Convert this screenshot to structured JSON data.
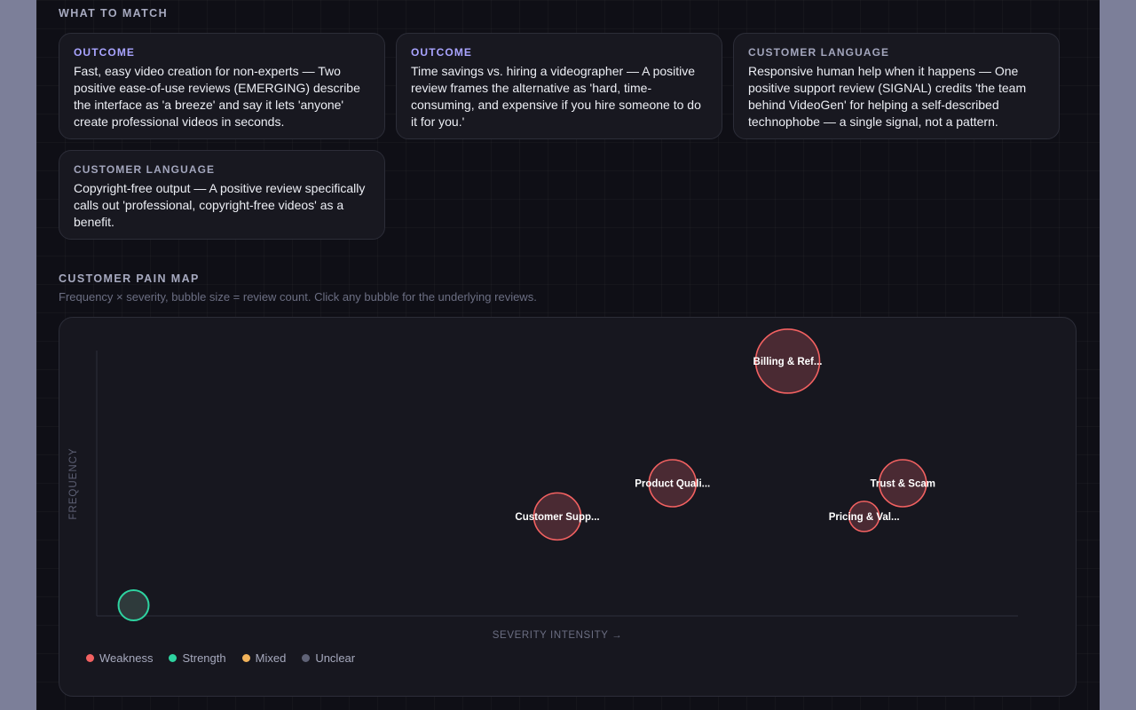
{
  "match_section": {
    "title": "WHAT TO MATCH",
    "cards": [
      {
        "label": "OUTCOME",
        "text": "Fast, easy video creation for non-experts — Two positive ease-of-use reviews (EMERGING) describe the interface as 'a breeze' and say it lets 'anyone' create professional videos in seconds."
      },
      {
        "label": "OUTCOME",
        "text": "Time savings vs. hiring a videographer — A positive review frames the alternative as 'hard, time-consuming, and expensive if you hire someone to do it for you.'"
      },
      {
        "label": "CUSTOMER LANGUAGE",
        "text": "Responsive human help when it happens — One positive support review (SIGNAL) credits 'the team behind VideoGen' for helping a self-described technophobe — a single signal, not a pattern."
      },
      {
        "label": "CUSTOMER LANGUAGE",
        "text": "Copyright-free output — A positive review specifically calls out 'professional, copyright-free videos' as a benefit."
      }
    ]
  },
  "pain_map": {
    "title": "CUSTOMER PAIN MAP",
    "subtitle": "Frequency × severity, bubble size = review count. Click any bubble for the underlying reviews.",
    "y_axis_label": "FREQUENCY",
    "x_axis_label": "SEVERITY INTENSITY →",
    "legend": [
      {
        "label": "Weakness",
        "color": "#f26161"
      },
      {
        "label": "Strength",
        "color": "#2ed3a0"
      },
      {
        "label": "Mixed",
        "color": "#f2b35a"
      },
      {
        "label": "Unclear",
        "color": "#5f6276"
      }
    ]
  },
  "chart_data": {
    "type": "scatter",
    "xlabel": "SEVERITY INTENSITY →",
    "ylabel": "FREQUENCY",
    "xlim": [
      0,
      1
    ],
    "ylim": [
      0,
      1
    ],
    "grid": false,
    "legend_position": "bottom-left",
    "points": [
      {
        "label": "Billing & Ref...",
        "x": 0.75,
        "y": 0.96,
        "size": 3,
        "sentiment": "Weakness"
      },
      {
        "label": "Product Quali...",
        "x": 0.625,
        "y": 0.5,
        "size": 2,
        "sentiment": "Weakness"
      },
      {
        "label": "Trust & Scam",
        "x": 0.875,
        "y": 0.5,
        "size": 2,
        "sentiment": "Weakness"
      },
      {
        "label": "Customer Supp...",
        "x": 0.5,
        "y": 0.375,
        "size": 2,
        "sentiment": "Weakness"
      },
      {
        "label": "Pricing & Val...",
        "x": 0.833,
        "y": 0.375,
        "size": 1,
        "sentiment": "Weakness"
      },
      {
        "label": "",
        "x": 0.04,
        "y": 0.04,
        "size": 1,
        "sentiment": "Strength"
      }
    ]
  }
}
